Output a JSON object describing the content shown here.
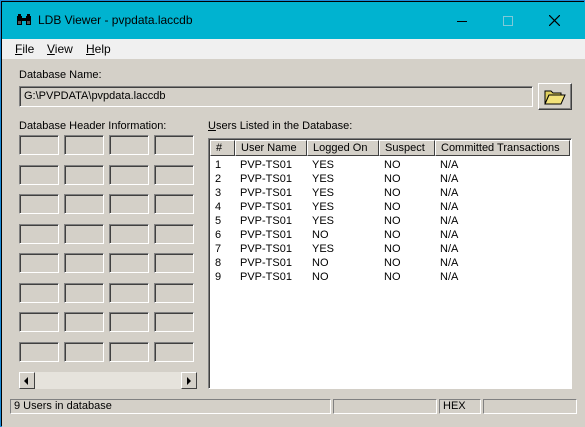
{
  "window": {
    "title": "LDB Viewer - pvpdata.laccdb",
    "app_icon": "binoculars-icon",
    "titlebar_color": "#00b3d0"
  },
  "menu": {
    "items": [
      {
        "label": "File",
        "accel": "F"
      },
      {
        "label": "View",
        "accel": "V"
      },
      {
        "label": "Help",
        "accel": "H"
      }
    ]
  },
  "database": {
    "name_label": "Database Name:",
    "name_value": "G:\\PVPDATA\\pvpdata.laccdb",
    "open_button_icon": "folder-open-icon"
  },
  "header_info": {
    "label": "Database Header Information:"
  },
  "users": {
    "label": "Users Listed in the Database:",
    "columns": [
      "#",
      "User Name",
      "Logged On",
      "Suspect",
      "Committed Transactions"
    ],
    "rows": [
      [
        "1",
        "PVP-TS01",
        "YES",
        "NO",
        "N/A"
      ],
      [
        "2",
        "PVP-TS01",
        "YES",
        "NO",
        "N/A"
      ],
      [
        "3",
        "PVP-TS01",
        "YES",
        "NO",
        "N/A"
      ],
      [
        "4",
        "PVP-TS01",
        "YES",
        "NO",
        "N/A"
      ],
      [
        "5",
        "PVP-TS01",
        "YES",
        "NO",
        "N/A"
      ],
      [
        "6",
        "PVP-TS01",
        "NO",
        "NO",
        "N/A"
      ],
      [
        "7",
        "PVP-TS01",
        "YES",
        "NO",
        "N/A"
      ],
      [
        "8",
        "PVP-TS01",
        "NO",
        "NO",
        "N/A"
      ],
      [
        "9",
        "PVP-TS01",
        "NO",
        "NO",
        "N/A"
      ]
    ]
  },
  "status": {
    "count_text": "9 Users in database",
    "mode_text": "HEX"
  }
}
